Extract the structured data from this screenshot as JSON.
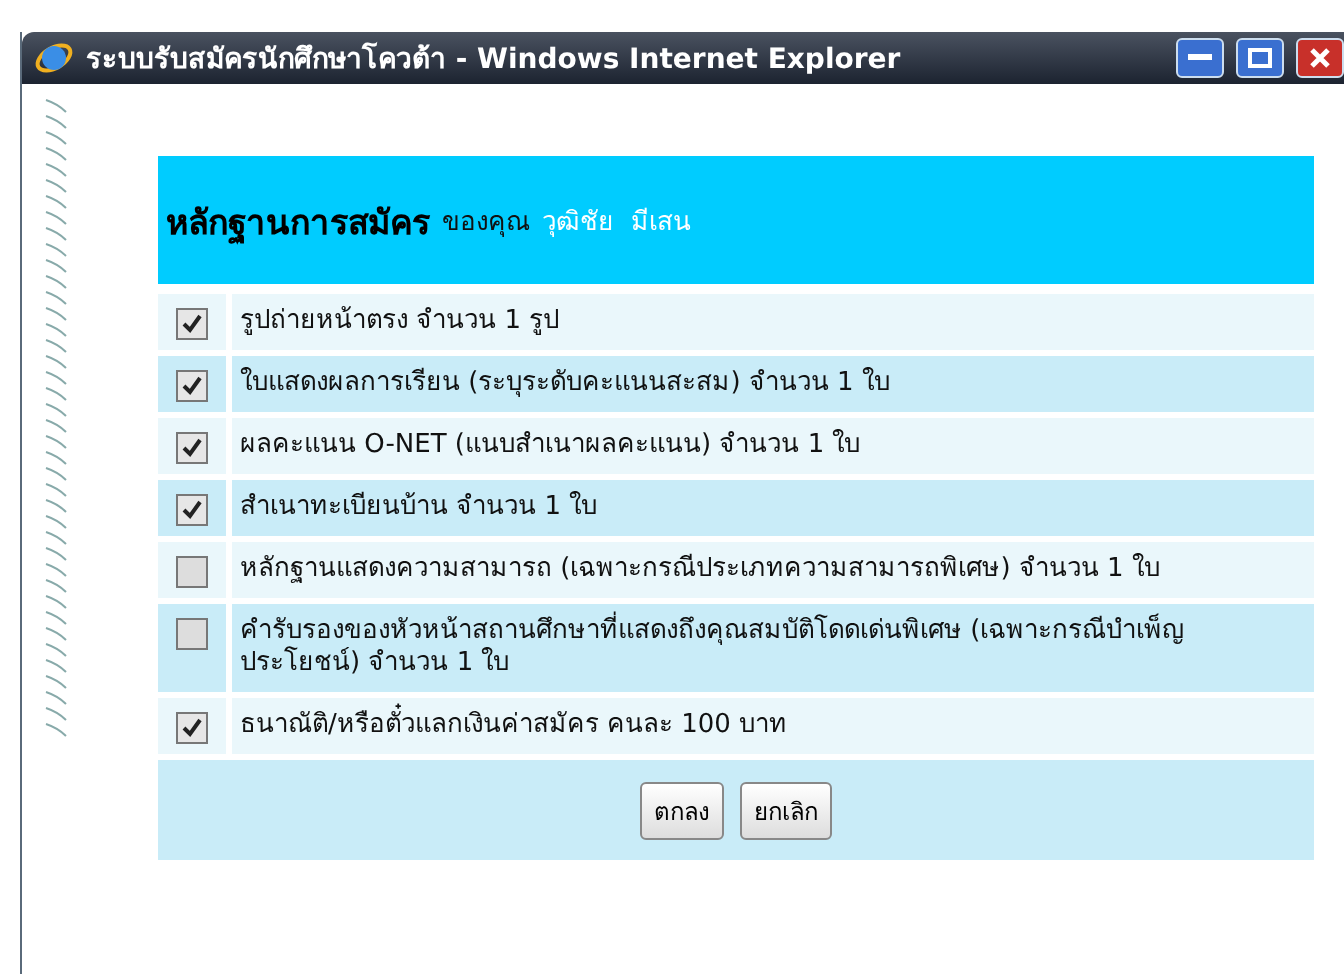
{
  "window": {
    "title": "ระบบรับสมัครนักศึกษาโควต้า - Windows Internet Explorer"
  },
  "header": {
    "title": "หลักฐานการสมัคร",
    "owner_label": "ของคุณ",
    "name": "วุฒิชัย  มีเสน"
  },
  "items": [
    {
      "label": "รูปถ่ายหน้าตรง จำนวน 1 รูป",
      "checked": true
    },
    {
      "label": "ใบแสดงผลการเรียน (ระบุระดับคะแนนสะสม) จำนวน 1 ใบ",
      "checked": true
    },
    {
      "label": "ผลคะแนน O-NET (แนบสำเนาผลคะแนน) จำนวน 1 ใบ",
      "checked": true
    },
    {
      "label": "สำเนาทะเบียนบ้าน จำนวน 1 ใบ",
      "checked": true
    },
    {
      "label": "หลักฐานแสดงความสามารถ (เฉพาะกรณีประเภทความสามารถพิเศษ) จำนวน 1 ใบ",
      "checked": false
    },
    {
      "label": "คำรับรองของหัวหน้าสถานศึกษาที่แสดงถึงคุณสมบัติโดดเด่นพิเศษ (เฉพาะกรณีบำเพ็ญประโยชน์) จำนวน 1 ใบ",
      "checked": false
    },
    {
      "label": "ธนาณัติ/หรือตั๋วแลกเงินค่าสมัคร คนละ 100 บาท",
      "checked": true
    }
  ],
  "buttons": [
    "ตกลง",
    "ยกเลิก"
  ]
}
